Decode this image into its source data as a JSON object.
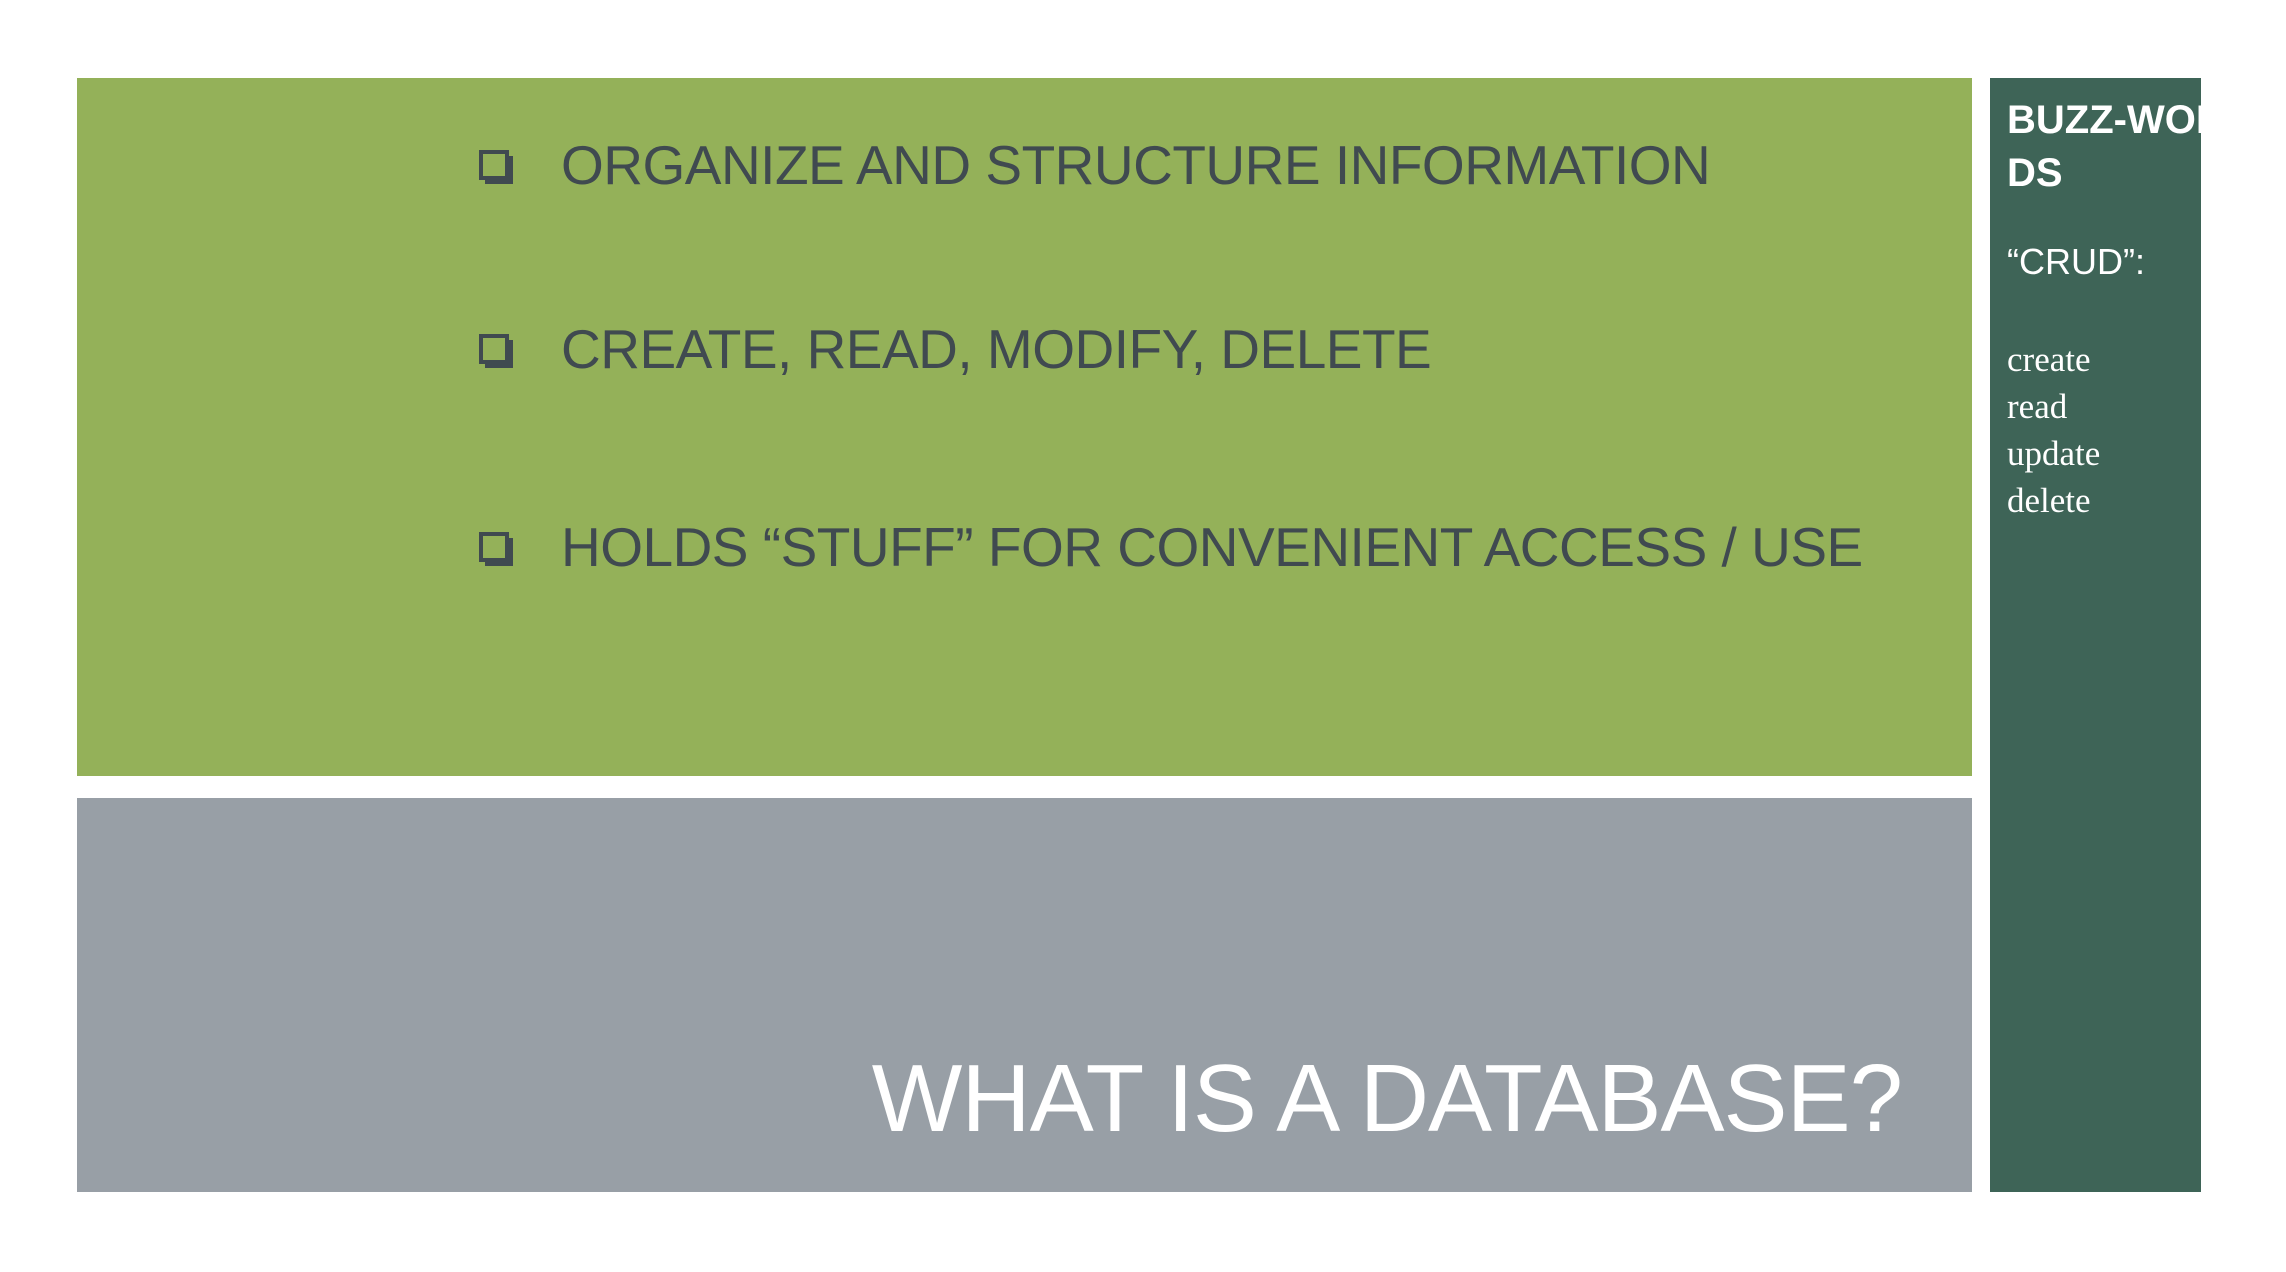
{
  "slide": {
    "title": "WHAT IS A DATABASE?",
    "bullets": [
      "ORGANIZE AND STRUCTURE INFORMATION",
      "CREATE,  READ, MODIFY, DELETE",
      "HOLDS “STUFF” FOR CONVENIENT ACCESS / USE"
    ]
  },
  "sidebar": {
    "heading": "BUZZ-WORDS",
    "subheading": "“CRUD”:",
    "terms": [
      "create",
      "read",
      "update",
      "delete"
    ]
  },
  "colors": {
    "content_panel": "#94b159",
    "title_panel": "#989fa6",
    "sidebar": "#3e6457",
    "bullet_text": "#404a50",
    "light_text": "#ffffff"
  }
}
